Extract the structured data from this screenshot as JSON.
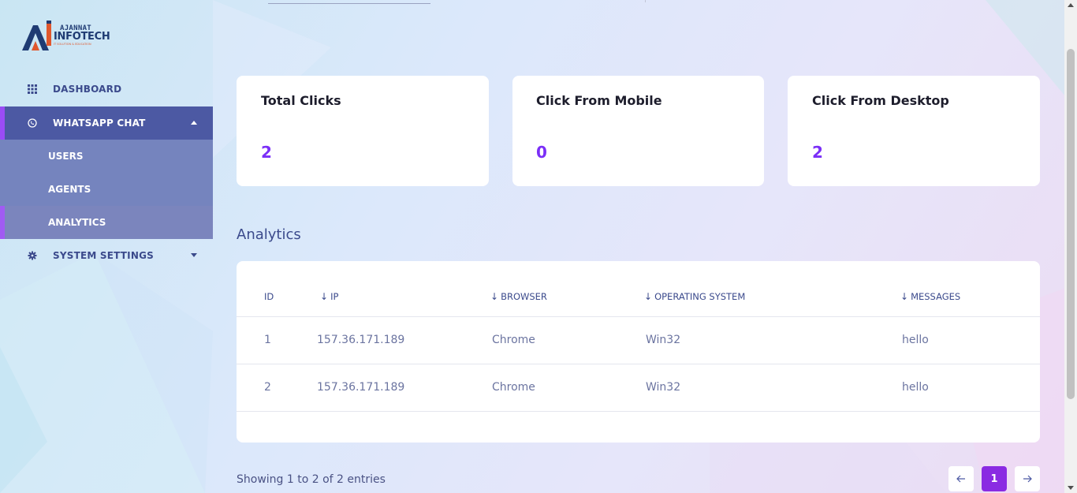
{
  "brand": {
    "line1": "AJANNAT",
    "line2": "INFOTECH",
    "tagline": "IT SOLUTION & EDUCATION"
  },
  "sidebar": {
    "items": [
      {
        "label": "DASHBOARD",
        "icon": "grid-icon"
      },
      {
        "label": "WHATSAPP CHAT",
        "icon": "whatsapp-icon",
        "expanded": true
      },
      {
        "label": "SYSTEM SETTINGS",
        "icon": "gear-icon"
      }
    ],
    "subitems": [
      {
        "label": "USERS"
      },
      {
        "label": "AGENTS"
      },
      {
        "label": "ANALYTICS",
        "active": true
      }
    ]
  },
  "cards": [
    {
      "title": "Total Clicks",
      "value": "2"
    },
    {
      "title": "Click From Mobile",
      "value": "0"
    },
    {
      "title": "Click From Desktop",
      "value": "2"
    }
  ],
  "section_title": "Analytics",
  "table": {
    "columns": [
      "ID",
      "IP",
      "BROWSER",
      "OPERATING SYSTEM",
      "MESSAGES"
    ],
    "rows": [
      [
        "1",
        "157.36.171.189",
        "Chrome",
        "Win32",
        "hello"
      ],
      [
        "2",
        "157.36.171.189",
        "Chrome",
        "Win32",
        "hello"
      ]
    ]
  },
  "footer": {
    "showing": "Showing 1 to 2 of 2 entries",
    "pages": [
      "1"
    ],
    "prev_icon": "arrow-left-icon",
    "next_icon": "arrow-right-icon"
  },
  "colors": {
    "accent": "#7b2ff7",
    "sidebar_active": "#4c59a3",
    "submenu": "#7584be"
  }
}
